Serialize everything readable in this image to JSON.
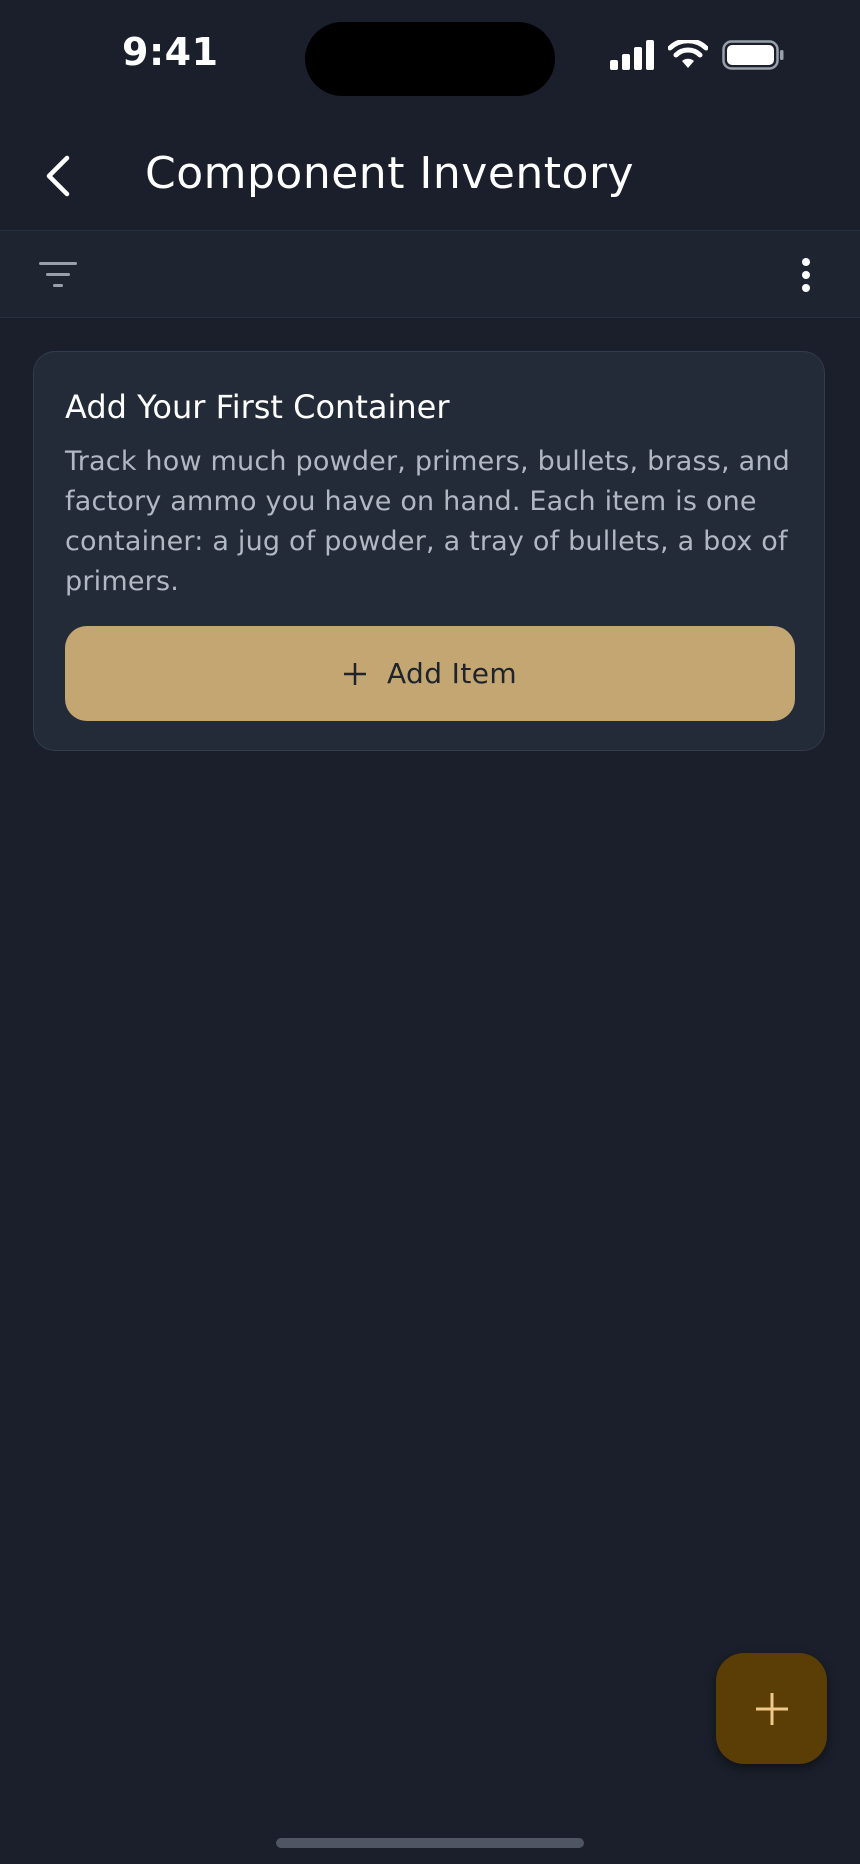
{
  "status_bar": {
    "time": "9:41",
    "icons": [
      "signal-icon",
      "wifi-icon",
      "battery-icon"
    ]
  },
  "app_bar": {
    "title": "Component Inventory",
    "back_icon": "chevron-left-icon"
  },
  "toolbar": {
    "filter_icon": "filter-icon",
    "more_icon": "more-vertical-icon"
  },
  "empty_card": {
    "title": "Add Your First Container",
    "description": "Track how much powder, primers, bullets, brass, and factory ammo you have on hand. Each item is one container: a jug of powder, a tray of bullets, a box of primers.",
    "button_label": "Add Item",
    "button_icon": "plus-icon"
  },
  "fab": {
    "icon": "plus-icon"
  },
  "colors": {
    "background": "#1a1f2b",
    "toolbar": "#1e2531",
    "card": "#232b38",
    "accent": "#c4a673",
    "fab": "#5a3e06",
    "fab_icon": "#f0c98a"
  }
}
